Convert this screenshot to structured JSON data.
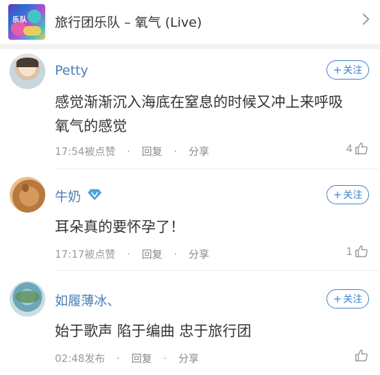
{
  "header": {
    "song_title": "旅行团乐队 – 氧气 (Live)",
    "cover_text": "乐队"
  },
  "comments": [
    {
      "user": "Petty",
      "follow_label": "关注",
      "text_line1": "感觉渐渐沉入海底在窒息的时候又冲上来呼吸",
      "text_line2": "氧气的感觉",
      "time": "17:54被点赞",
      "reply": "回复",
      "share": "分享",
      "likes": "4"
    },
    {
      "user": "牛奶",
      "badge_icon": "diamond-vip-icon",
      "follow_label": "关注",
      "text_line1": "耳朵真的要怀孕了！",
      "time": "17:17被点赞",
      "reply": "回复",
      "share": "分享",
      "likes": "1"
    },
    {
      "user": "如履薄冰、",
      "follow_label": "关注",
      "text_line1": "始于歌声 陷于编曲 忠于旅行团",
      "time": "02:48发布",
      "reply": "回复",
      "share": "分享"
    }
  ],
  "separator": "·",
  "colors": {
    "accent": "#3e7fcf",
    "username": "#4a7db5",
    "meta": "#9a9a9a"
  }
}
